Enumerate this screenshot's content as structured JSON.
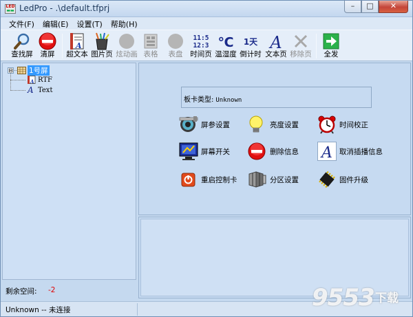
{
  "window": {
    "title": "LedPro - .\\default.tfprj",
    "controls": [
      "–",
      "□",
      "✕"
    ]
  },
  "menu": [
    {
      "label": "文件(F)"
    },
    {
      "label": "编辑(E)"
    },
    {
      "label": "设置(T)"
    },
    {
      "label": "帮助(H)"
    }
  ],
  "toolbar": [
    {
      "label": "查找屏",
      "icon": "magnifier-icon",
      "enabled": true
    },
    {
      "label": "清屏",
      "icon": "clear-screen-icon",
      "enabled": true
    },
    {
      "label": "超文本",
      "icon": "hypertext-icon",
      "enabled": true
    },
    {
      "label": "图片页",
      "icon": "picture-page-icon",
      "enabled": true
    },
    {
      "label": "炫动画",
      "icon": "animation-icon",
      "enabled": false
    },
    {
      "label": "表格",
      "icon": "table-icon",
      "enabled": false
    },
    {
      "label": "表盘",
      "icon": "dial-icon",
      "enabled": false
    },
    {
      "label": "时间页",
      "icon": "time-page-icon",
      "enabled": true,
      "glyph": "11:5\n12:3"
    },
    {
      "label": "温湿度",
      "icon": "temperature-icon",
      "enabled": true,
      "glyph": "℃"
    },
    {
      "label": "倒计时",
      "icon": "countdown-icon",
      "enabled": true,
      "glyph": "1天"
    },
    {
      "label": "文本页",
      "icon": "text-page-icon",
      "enabled": true,
      "glyph": "A"
    },
    {
      "label": "移除页",
      "icon": "remove-page-icon",
      "enabled": false,
      "glyph": "✕"
    },
    {
      "label": "全发",
      "icon": "send-all-icon",
      "enabled": true,
      "glyph": "➜"
    }
  ],
  "tree": {
    "root": {
      "label": "1号屏",
      "expander": "⊟"
    },
    "children": [
      {
        "label": "RTF",
        "icon": "rtf-page-icon"
      },
      {
        "label": "Text",
        "icon": "text-item-icon",
        "glyph": "A"
      }
    ]
  },
  "space": {
    "label": "剩余空间:",
    "value": "-2"
  },
  "status": {
    "text": "Unknown -- 未连接"
  },
  "board": {
    "label": "板卡类型:",
    "value": "Unknown"
  },
  "actions": [
    {
      "label": "屏参设置",
      "icon": "screen-params-icon"
    },
    {
      "label": "亮度设置",
      "icon": "brightness-bulb-icon"
    },
    {
      "label": "时间校正",
      "icon": "alarm-clock-icon"
    },
    {
      "label": "屏幕开关",
      "icon": "screen-power-icon"
    },
    {
      "label": "删除信息",
      "icon": "delete-info-icon"
    },
    {
      "label": "取消插播信息",
      "icon": "cancel-insert-icon",
      "glyph": "A"
    },
    {
      "label": "重启控制卡",
      "icon": "restart-card-icon"
    },
    {
      "label": "分区设置",
      "icon": "partition-icon"
    },
    {
      "label": "固件升级",
      "icon": "firmware-chip-icon"
    }
  ],
  "watermark": {
    "number": "9553",
    "text": "下载"
  }
}
